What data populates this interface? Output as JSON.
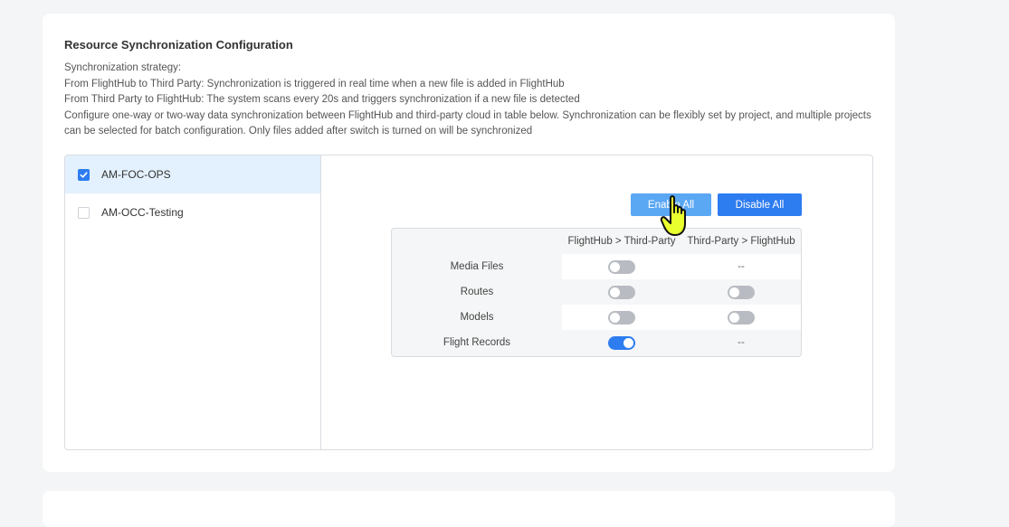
{
  "section": {
    "title": "Resource Synchronization Configuration",
    "description": [
      "Synchronization strategy:",
      "From FlightHub to Third Party: Synchronization is triggered in real time when a new file is added in FlightHub",
      "From Third Party to FlightHub: The system scans every 20s and triggers synchronization if a new file is detected",
      "Configure one-way or two-way data synchronization between FlightHub and third-party cloud in table below. Synchronization can be flexibly set by project, and multiple projects can be selected for batch configuration. Only files added after switch is turned on will be synchronized"
    ]
  },
  "projects": [
    {
      "label": "AM-FOC-OPS",
      "checked": true
    },
    {
      "label": "AM-OCC-Testing",
      "checked": false
    }
  ],
  "actions": {
    "enable_all": "Enable All",
    "disable_all": "Disable All"
  },
  "table": {
    "headers": [
      "",
      "FlightHub > Third-Party",
      "Third-Party > FlightHub"
    ],
    "rows": [
      {
        "label": "Media Files",
        "to_third_party": "off",
        "to_flighthub": "--"
      },
      {
        "label": "Routes",
        "to_third_party": "off",
        "to_flighthub": "off"
      },
      {
        "label": "Models",
        "to_third_party": "off",
        "to_flighthub": "off"
      },
      {
        "label": "Flight Records",
        "to_third_party": "on",
        "to_flighthub": "--"
      }
    ]
  },
  "colors": {
    "accent": "#2d7cf0",
    "accent_light": "#5aa7f3",
    "selected_bg": "#e3f0fd",
    "toggle_off": "#b8bcc2",
    "cursor_fill": "#e9ff2e"
  },
  "icons": {
    "checkbox_checked": "check-icon",
    "cursor": "hand-pointer-icon"
  }
}
